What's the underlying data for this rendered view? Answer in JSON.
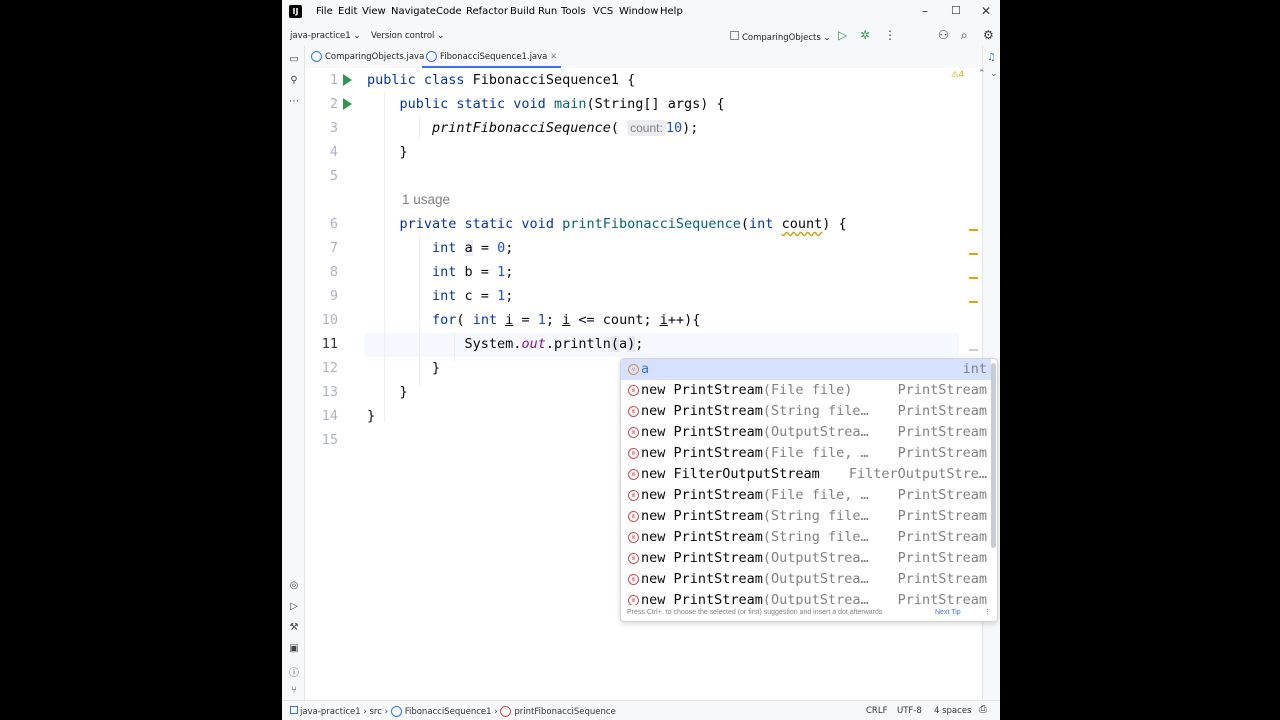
{
  "menu": [
    "File",
    "Edit",
    "View",
    "Navigate",
    "Code",
    "Refactor",
    "Build",
    "Run",
    "Tools",
    "VCS",
    "Window",
    "Help"
  ],
  "toolbar": {
    "project": "java-practice1",
    "vcs": "Version control",
    "run_config": "ComparingObjects"
  },
  "tabs": [
    {
      "label": "ComparingObjects.java"
    },
    {
      "label": "FibonacciSequence1.java"
    }
  ],
  "inspection": {
    "warning_count": "⚠4"
  },
  "editor": {
    "line_numbers": [
      "1",
      "2",
      "3",
      "4",
      "5",
      "6",
      "7",
      "8",
      "9",
      "10",
      "11",
      "12",
      "13",
      "14",
      "15"
    ],
    "usage_hint": "1 usage",
    "param_hint": "count:"
  },
  "completion": {
    "items": [
      {
        "name": "a",
        "params": "",
        "type": "int"
      },
      {
        "name": "new PrintStream",
        "params": "(File file)",
        "type": "PrintStream"
      },
      {
        "name": "new PrintStream",
        "params": "(String file…",
        "type": "PrintStream"
      },
      {
        "name": "new PrintStream",
        "params": "(OutputStrea…",
        "type": "PrintStream"
      },
      {
        "name": "new PrintStream",
        "params": "(File file, …",
        "type": "PrintStream"
      },
      {
        "name": "new FilterOutputStream",
        "params": "",
        "type": "FilterOutputStre…"
      },
      {
        "name": "new PrintStream",
        "params": "(File file, …",
        "type": "PrintStream"
      },
      {
        "name": "new PrintStream",
        "params": "(String file…",
        "type": "PrintStream"
      },
      {
        "name": "new PrintStream",
        "params": "(String file…",
        "type": "PrintStream"
      },
      {
        "name": "new PrintStream",
        "params": "(OutputStrea…",
        "type": "PrintStream"
      },
      {
        "name": "new PrintStream",
        "params": "(OutputStrea…",
        "type": "PrintStream"
      },
      {
        "name": "new PrintStream",
        "params": "(OutputStrea…",
        "type": "PrintStream"
      }
    ],
    "footer_tip": "Press Ctrl+. to choose the selected (or first) suggestion and insert a dot afterwards",
    "next_tip": "Next Tip"
  },
  "statusbar": {
    "breadcrumbs": [
      "java-practice1",
      "src",
      "FibonacciSequence1",
      "printFibonacciSequence"
    ],
    "line_sep": "CRLF",
    "encoding": "UTF-8",
    "indent": "4 spaces"
  },
  "colors": {
    "accent": "#3574f0",
    "keyword": "#0033b3",
    "method": "#00627a",
    "number": "#1750eb",
    "run": "#369650"
  }
}
